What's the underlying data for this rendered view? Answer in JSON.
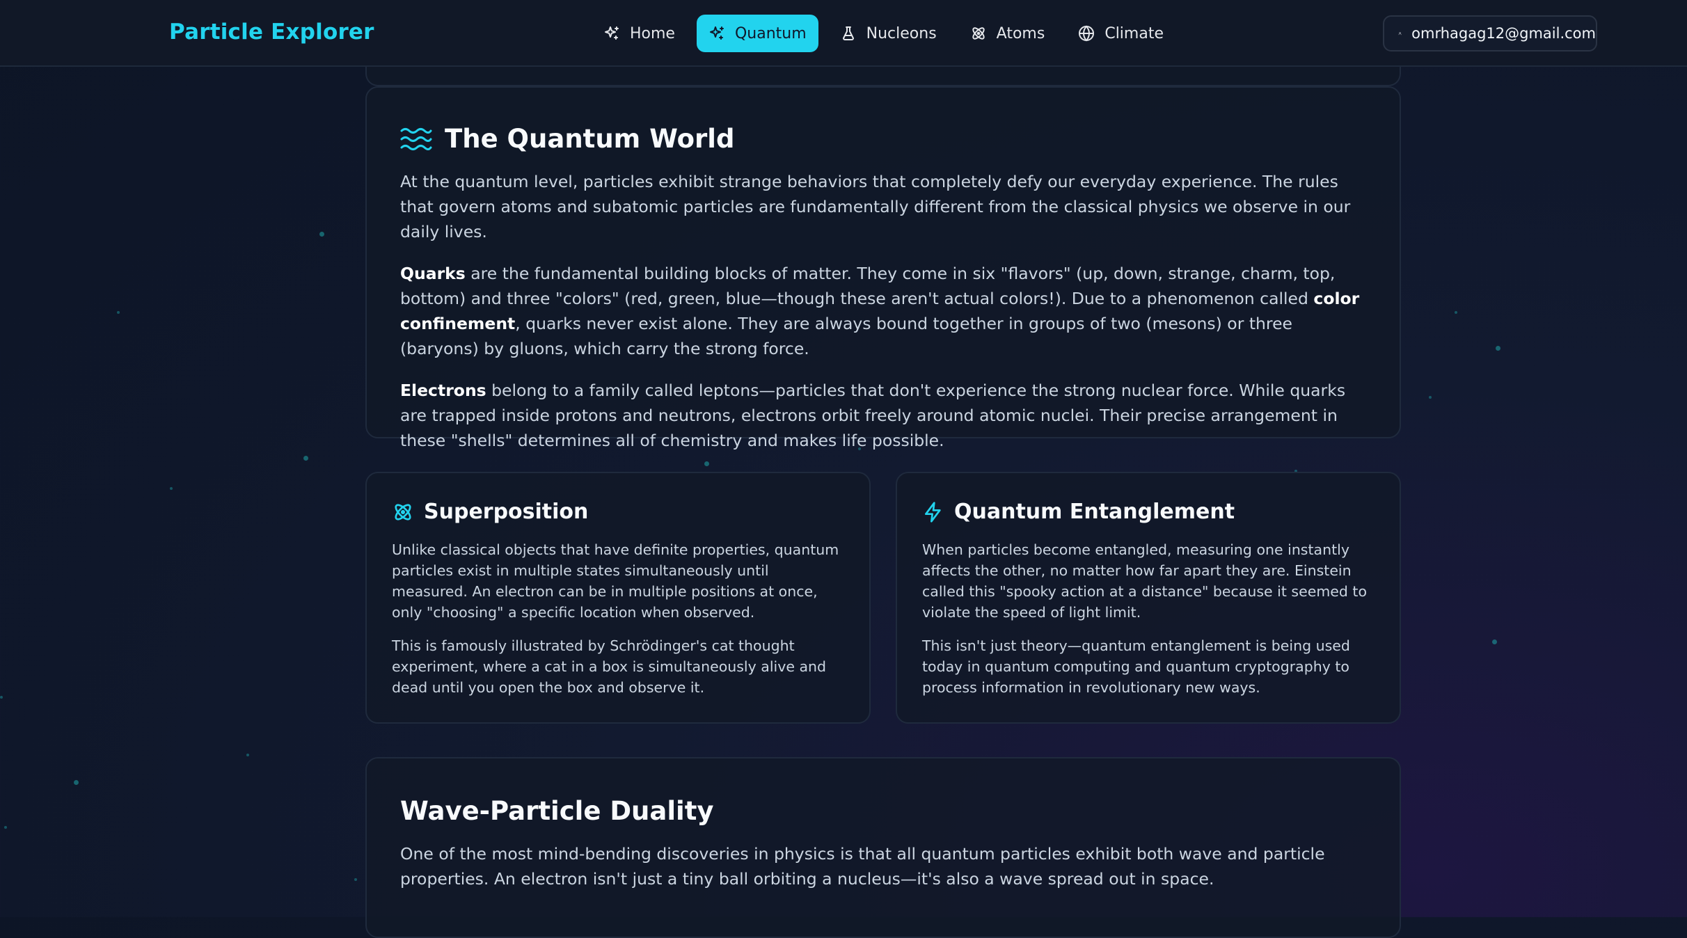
{
  "navbar": {
    "brand": "Particle Explorer",
    "items": [
      {
        "label": "Home",
        "icon": "sparkles-icon"
      },
      {
        "label": "Quantum",
        "icon": "sparkles-icon",
        "active": true
      },
      {
        "label": "Nucleons",
        "icon": "flask-icon"
      },
      {
        "label": "Atoms",
        "icon": "atom-icon"
      },
      {
        "label": "Climate",
        "icon": "globe-icon"
      }
    ],
    "user_email": "omrhagag12@gmail.com"
  },
  "colors": {
    "accent": "#22d3ee",
    "background": "#0f172a",
    "card": "#111827"
  },
  "quantum_world": {
    "title": "The Quantum World",
    "intro": "At the quantum level, particles exhibit strange behaviors that completely defy our everyday experience. The rules that govern atoms and subatomic particles are fundamentally different from the classical physics we observe in our daily lives.",
    "quarks_term": "Quarks",
    "quarks_text_1": " are the fundamental building blocks of matter. They come in six \"flavors\" (up, down, strange, charm, top, bottom) and three \"colors\" (red, green, blue—though these aren't actual colors!). Due to a phenomenon called ",
    "quarks_term_2": "color confinement",
    "quarks_text_2": ", quarks never exist alone. They are always bound together in groups of two (mesons) or three (baryons) by gluons, which carry the strong force.",
    "electrons_term": "Electrons",
    "electrons_text": " belong to a family called leptons—particles that don't experience the strong nuclear force. While quarks are trapped inside protons and neutrons, electrons orbit freely around atomic nuclei. Their precise arrangement in these \"shells\" determines all of chemistry and makes life possible."
  },
  "superposition": {
    "title": "Superposition",
    "p1": "Unlike classical objects that have definite properties, quantum particles exist in multiple states simultaneously until measured. An electron can be in multiple positions at once, only \"choosing\" a specific location when observed.",
    "p2": "This is famously illustrated by Schrödinger's cat thought experiment, where a cat in a box is simultaneously alive and dead until you open the box and observe it."
  },
  "entanglement": {
    "title": "Quantum Entanglement",
    "p1": "When particles become entangled, measuring one instantly affects the other, no matter how far apart they are. Einstein called this \"spooky action at a distance\" because it seemed to violate the speed of light limit.",
    "p2": "This isn't just theory—quantum entanglement is being used today in quantum computing and quantum cryptography to process information in revolutionary new ways."
  },
  "wave_particle": {
    "title": "Wave-Particle Duality",
    "p1": "One of the most mind-bending discoveries in physics is that all quantum particles exhibit both wave and particle properties. An electron isn't just a tiny ball orbiting a nucleus—it's also a wave spread out in space."
  }
}
